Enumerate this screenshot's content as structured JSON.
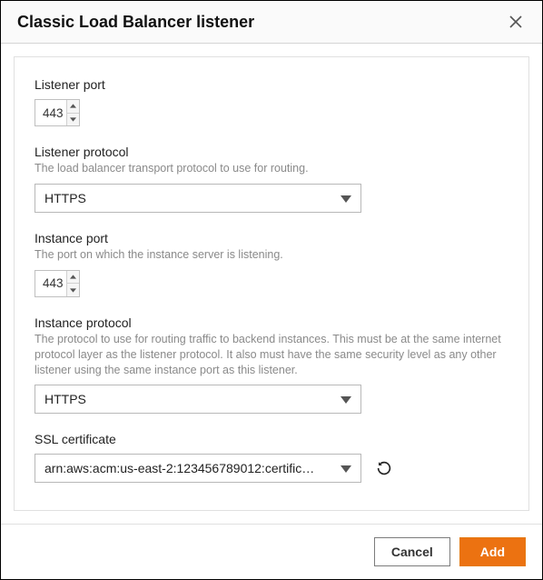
{
  "header": {
    "title": "Classic Load Balancer listener"
  },
  "fields": {
    "listener_port": {
      "label": "Listener port",
      "value": "443"
    },
    "listener_protocol": {
      "label": "Listener protocol",
      "desc": "The load balancer transport protocol to use for routing.",
      "value": "HTTPS"
    },
    "instance_port": {
      "label": "Instance port",
      "desc": "The port on which the instance server is listening.",
      "value": "443"
    },
    "instance_protocol": {
      "label": "Instance protocol",
      "desc": "The protocol to use for routing traffic to backend instances. This must be at the same internet protocol layer as the listener protocol. It also must have the same security level as any other listener using the same instance port as this listener.",
      "value": "HTTPS"
    },
    "ssl_certificate": {
      "label": "SSL certificate",
      "value": "arn:aws:acm:us-east-2:123456789012:certific…"
    }
  },
  "footer": {
    "cancel": "Cancel",
    "add": "Add"
  }
}
